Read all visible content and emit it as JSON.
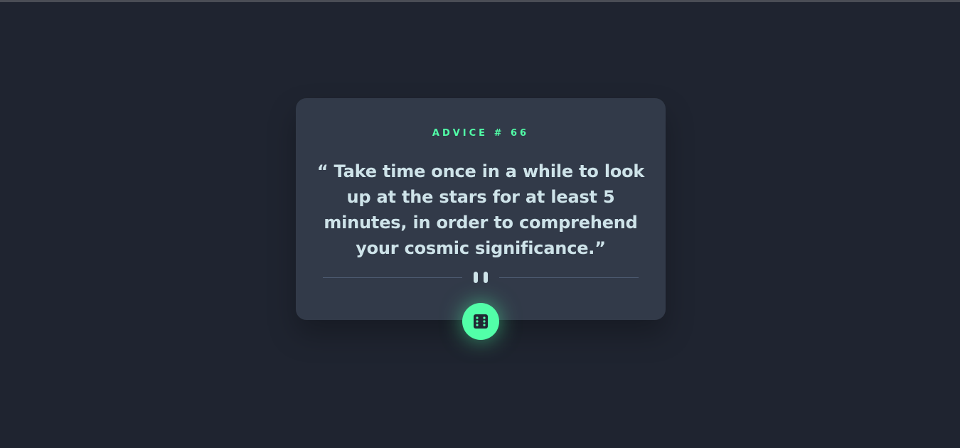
{
  "card": {
    "advice_label": "ADVICE #",
    "advice_number": "66",
    "quote": "“ Take time once in a while to look up at the stars for at least 5 minutes, in order to comprehend your cosmic significance.”"
  },
  "colors": {
    "background": "#1f2430",
    "card": "#323a49",
    "accent": "#52ffa8",
    "text": "#cee3e9",
    "divider": "#4f5d74"
  },
  "icons": {
    "divider": "pause-icon",
    "button": "dice-icon"
  }
}
